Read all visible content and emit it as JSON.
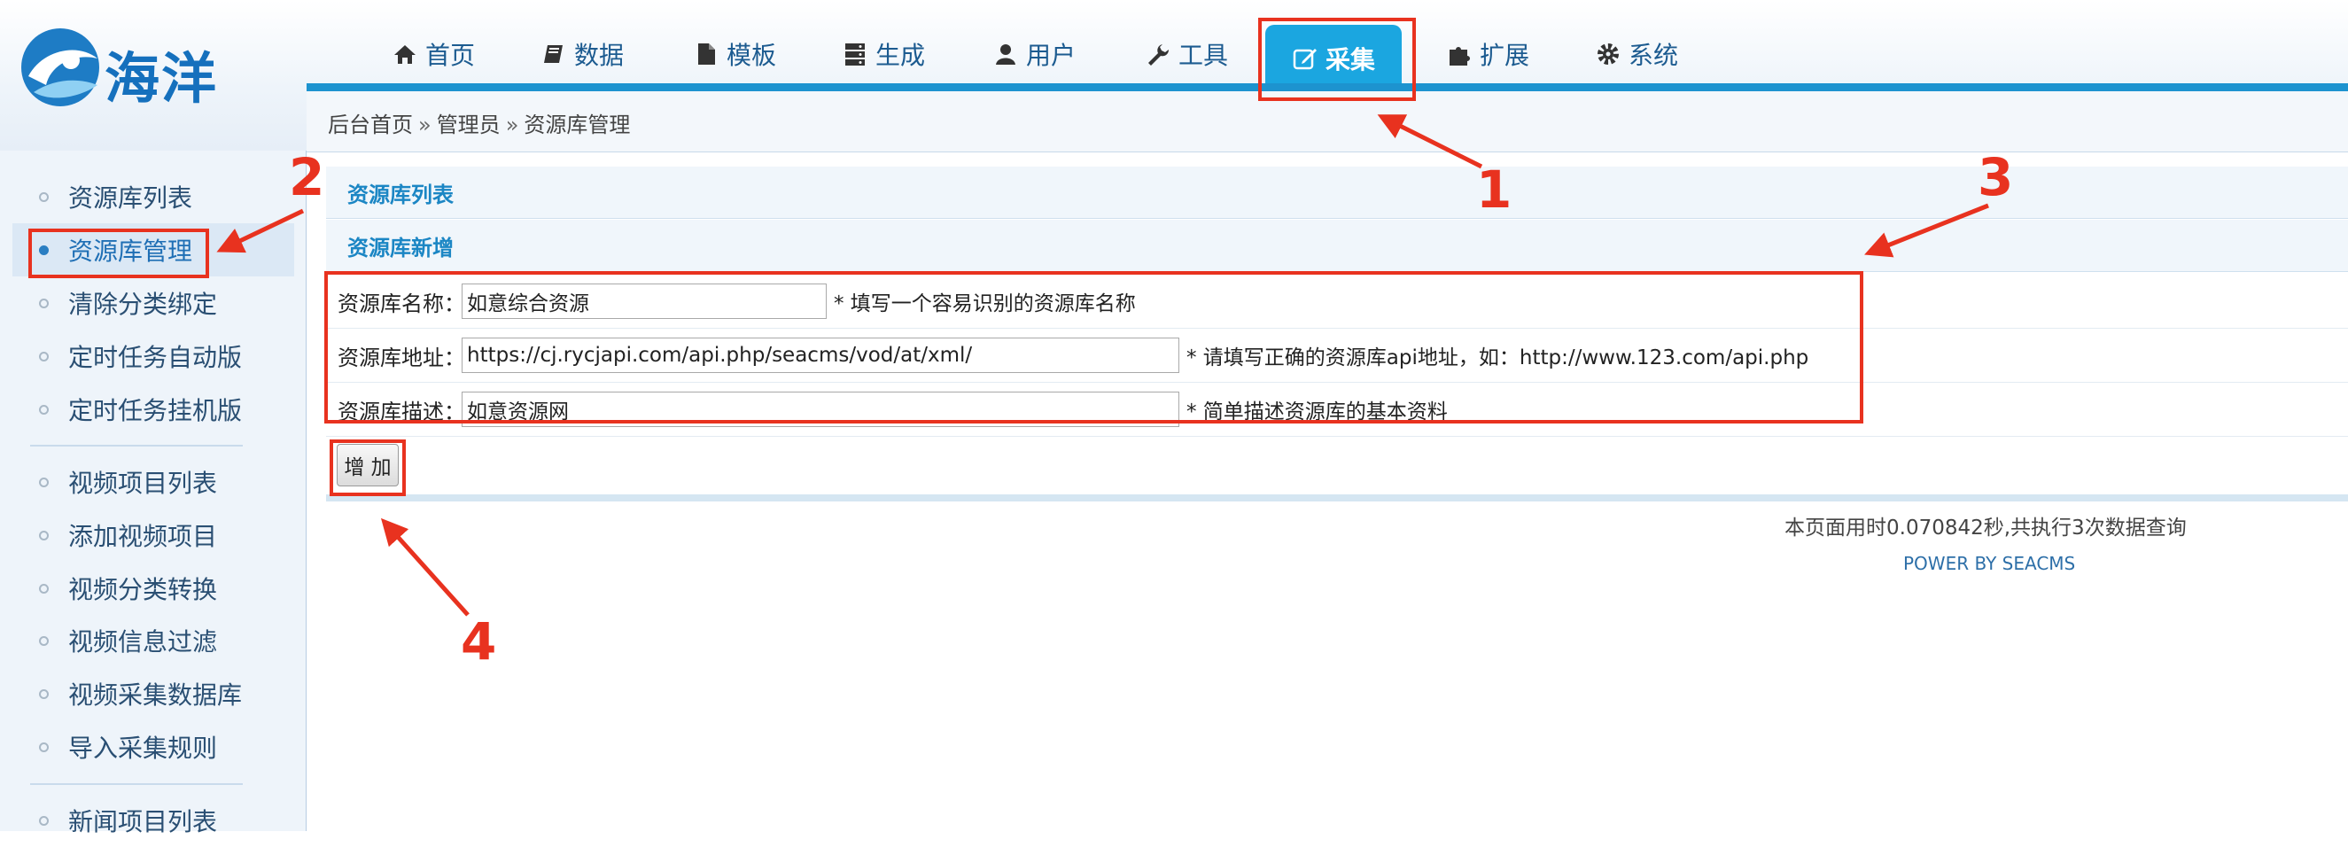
{
  "logo": {
    "text": "海洋"
  },
  "nav": {
    "items": [
      {
        "label": "首页",
        "icon": "home-icon"
      },
      {
        "label": "数据",
        "icon": "book-icon"
      },
      {
        "label": "模板",
        "icon": "file-icon"
      },
      {
        "label": "生成",
        "icon": "server-icon"
      },
      {
        "label": "用户",
        "icon": "user-icon"
      },
      {
        "label": "工具",
        "icon": "wrench-icon"
      },
      {
        "label": "采集",
        "icon": "edit-icon",
        "active": true
      },
      {
        "label": "扩展",
        "icon": "puzzle-icon"
      },
      {
        "label": "系统",
        "icon": "gear-icon"
      }
    ]
  },
  "breadcrumb": {
    "parts": [
      "后台首页",
      "管理员",
      "资源库管理"
    ],
    "separator": "»"
  },
  "sidebar": {
    "items": [
      {
        "label": "资源库列表"
      },
      {
        "label": "资源库管理",
        "active": true
      },
      {
        "label": "清除分类绑定"
      },
      {
        "label": "定时任务自动版"
      },
      {
        "label": "定时任务挂机版"
      },
      {
        "label": "视频项目列表"
      },
      {
        "label": "添加视频项目"
      },
      {
        "label": "视频分类转换"
      },
      {
        "label": "视频信息过滤"
      },
      {
        "label": "视频采集数据库"
      },
      {
        "label": "导入采集规则"
      },
      {
        "label": "新闻项目列表"
      }
    ]
  },
  "main": {
    "section_list_title": "资源库列表",
    "section_add_title": "资源库新增",
    "form": {
      "name": {
        "label": "资源库名称：",
        "value": "如意综合资源",
        "hint": "* 填写一个容易识别的资源库名称"
      },
      "address": {
        "label": "资源库地址：",
        "value": "https://cj.rycjapi.com/api.php/seacms/vod/at/xml/",
        "hint": "* 请填写正确的资源库api地址，如：http://www.123.com/api.php"
      },
      "desc": {
        "label": "资源库描述：",
        "value": "如意资源网",
        "hint": "* 简单描述资源库的基本资料"
      }
    },
    "add_button_label": "增 加"
  },
  "footer": {
    "stats": "本页面用时0.070842秒,共执行3次数据查询",
    "power": "POWER BY SEACMS"
  },
  "annotations": {
    "n1": "1",
    "n2": "2",
    "n3": "3",
    "n4": "4"
  },
  "colors": {
    "accent": "#1ba6e0",
    "nav_rule": "#1d93cf",
    "annotation_red": "#e8321f",
    "link_blue": "#1b86c4"
  }
}
